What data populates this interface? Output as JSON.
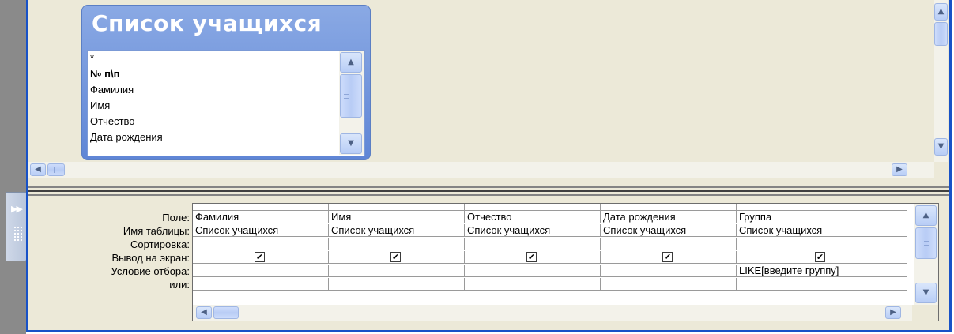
{
  "table_box": {
    "title": "Список учащихся",
    "fields": [
      "*",
      "№ п\\п",
      "Фамилия",
      "Имя",
      "Отчество",
      "Дата рождения"
    ]
  },
  "grid": {
    "row_labels": [
      "Поле:",
      "Имя таблицы:",
      "Сортировка:",
      "Вывод на экран:",
      "Условие отбора:",
      "или:"
    ],
    "columns": [
      {
        "field": "Фамилия",
        "table": "Список учащихся",
        "sort": "",
        "show": true,
        "criteria": "",
        "or": ""
      },
      {
        "field": "Имя",
        "table": "Список учащихся",
        "sort": "",
        "show": true,
        "criteria": "",
        "or": ""
      },
      {
        "field": "Отчество",
        "table": "Список учащихся",
        "sort": "",
        "show": true,
        "criteria": "",
        "or": ""
      },
      {
        "field": "Дата рождения",
        "table": "Список учащихся",
        "sort": "",
        "show": true,
        "criteria": "",
        "or": ""
      },
      {
        "field": "Группа",
        "table": "Список учащихся",
        "sort": "",
        "show": true,
        "criteria": "LIKE[введите группу]",
        "or": ""
      }
    ],
    "check_mark": "✔"
  },
  "icons": {
    "up": "▲",
    "down": "▼",
    "left": "◀",
    "right": "▶",
    "expand": "▶▶"
  },
  "colors": {
    "frame": "#1852c7",
    "panel": "#ece9d8",
    "title_bar": "#6f93db"
  }
}
